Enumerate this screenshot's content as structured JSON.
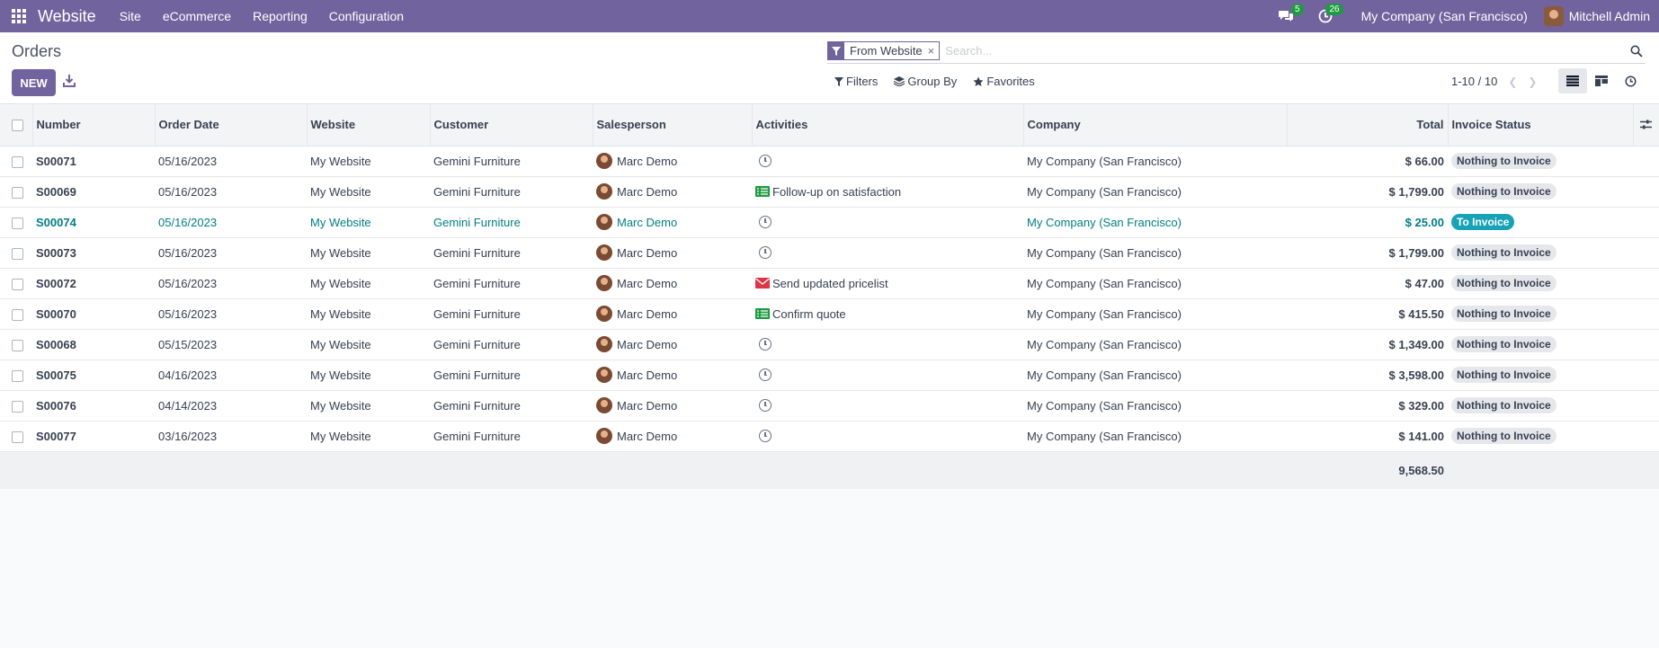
{
  "nav": {
    "brand": "Website",
    "menu": [
      "Site",
      "eCommerce",
      "Reporting",
      "Configuration"
    ],
    "messages_count": "5",
    "activities_count": "26",
    "company": "My Company (San Francisco)",
    "user": "Mitchell Admin"
  },
  "control": {
    "breadcrumb": "Orders",
    "new_label": "NEW",
    "facet_label": "From Website",
    "facet_remove": "×",
    "search_placeholder": "Search...",
    "filters_label": "Filters",
    "groupby_label": "Group By",
    "favorites_label": "Favorites",
    "pager": "1-10 / 10"
  },
  "table": {
    "headers": {
      "number": "Number",
      "order_date": "Order Date",
      "website": "Website",
      "customer": "Customer",
      "salesperson": "Salesperson",
      "activities": "Activities",
      "company": "Company",
      "total": "Total",
      "invoice_status": "Invoice Status"
    },
    "rows": [
      {
        "number": "S00071",
        "date": "05/16/2023",
        "website": "My Website",
        "customer": "Gemini Furniture",
        "salesperson": "Marc Demo",
        "activity": "",
        "activity_icon": "clock-icon",
        "company": "My Company (San Francisco)",
        "total": "$ 66.00",
        "status": "Nothing to Invoice"
      },
      {
        "number": "S00069",
        "date": "05/16/2023",
        "website": "My Website",
        "customer": "Gemini Furniture",
        "salesperson": "Marc Demo",
        "activity": "Follow-up on satisfaction",
        "activity_icon": "todo-list-icon",
        "company": "My Company (San Francisco)",
        "total": "$ 1,799.00",
        "status": "Nothing to Invoice"
      },
      {
        "number": "S00074",
        "date": "05/16/2023",
        "website": "My Website",
        "customer": "Gemini Furniture",
        "salesperson": "Marc Demo",
        "activity": "",
        "activity_icon": "clock-icon",
        "company": "My Company (San Francisco)",
        "total": "$ 25.00",
        "status": "To Invoice"
      },
      {
        "number": "S00073",
        "date": "05/16/2023",
        "website": "My Website",
        "customer": "Gemini Furniture",
        "salesperson": "Marc Demo",
        "activity": "",
        "activity_icon": "clock-icon",
        "company": "My Company (San Francisco)",
        "total": "$ 1,799.00",
        "status": "Nothing to Invoice"
      },
      {
        "number": "S00072",
        "date": "05/16/2023",
        "website": "My Website",
        "customer": "Gemini Furniture",
        "salesperson": "Marc Demo",
        "activity": "Send updated pricelist",
        "activity_icon": "envelope-icon",
        "company": "My Company (San Francisco)",
        "total": "$ 47.00",
        "status": "Nothing to Invoice"
      },
      {
        "number": "S00070",
        "date": "05/16/2023",
        "website": "My Website",
        "customer": "Gemini Furniture",
        "salesperson": "Marc Demo",
        "activity": "Confirm quote",
        "activity_icon": "todo-list-icon",
        "company": "My Company (San Francisco)",
        "total": "$ 415.50",
        "status": "Nothing to Invoice"
      },
      {
        "number": "S00068",
        "date": "05/15/2023",
        "website": "My Website",
        "customer": "Gemini Furniture",
        "salesperson": "Marc Demo",
        "activity": "",
        "activity_icon": "clock-icon",
        "company": "My Company (San Francisco)",
        "total": "$ 1,349.00",
        "status": "Nothing to Invoice"
      },
      {
        "number": "S00075",
        "date": "04/16/2023",
        "website": "My Website",
        "customer": "Gemini Furniture",
        "salesperson": "Marc Demo",
        "activity": "",
        "activity_icon": "clock-icon",
        "company": "My Company (San Francisco)",
        "total": "$ 3,598.00",
        "status": "Nothing to Invoice"
      },
      {
        "number": "S00076",
        "date": "04/14/2023",
        "website": "My Website",
        "customer": "Gemini Furniture",
        "salesperson": "Marc Demo",
        "activity": "",
        "activity_icon": "clock-icon",
        "company": "My Company (San Francisco)",
        "total": "$ 329.00",
        "status": "Nothing to Invoice"
      },
      {
        "number": "S00077",
        "date": "03/16/2023",
        "website": "My Website",
        "customer": "Gemini Furniture",
        "salesperson": "Marc Demo",
        "activity": "",
        "activity_icon": "clock-icon",
        "company": "My Company (San Francisco)",
        "total": "$ 141.00",
        "status": "Nothing to Invoice"
      }
    ],
    "grand_total": "9,568.50"
  },
  "colors": {
    "brand": "#71639e",
    "badge": "#1d9b3f",
    "link": "#017e84",
    "to_invoice": "#17a2b8"
  }
}
